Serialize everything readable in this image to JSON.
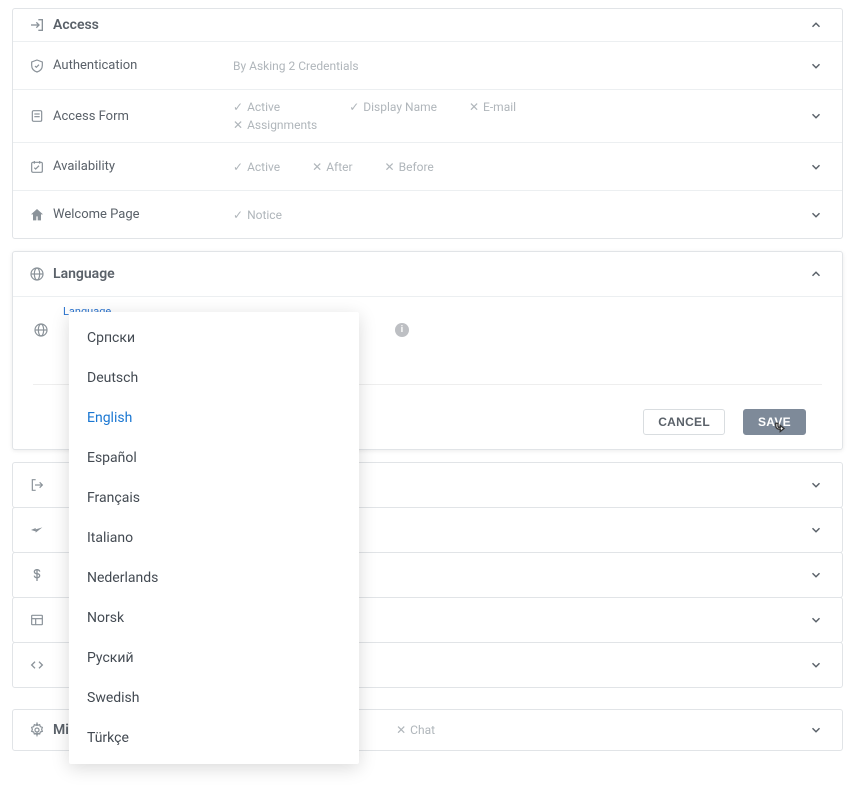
{
  "access": {
    "title": "Access",
    "rows": {
      "authentication": {
        "label": "Authentication",
        "summary": "By Asking 2 Credentials"
      },
      "accessForm": {
        "label": "Access Form",
        "facts": {
          "active": {
            "text": "Active",
            "on": true
          },
          "assignments": {
            "text": "Assignments",
            "on": false
          },
          "displayName": {
            "text": "Display Name",
            "on": true
          },
          "email": {
            "text": "E-mail",
            "on": false
          }
        }
      },
      "availability": {
        "label": "Availability",
        "facts": {
          "active": {
            "text": "Active",
            "on": true
          },
          "after": {
            "text": "After",
            "on": false
          },
          "before": {
            "text": "Before",
            "on": false
          }
        }
      },
      "welcome": {
        "label": "Welcome Page",
        "facts": {
          "notice": {
            "text": "Notice",
            "on": true
          }
        }
      }
    }
  },
  "language": {
    "title": "Language",
    "fieldLabel": "Language",
    "options": [
      "Српски",
      "Deutsch",
      "English",
      "Español",
      "Français",
      "Italiano",
      "Nederlands",
      "Norsk",
      "Руский",
      "Swedish",
      "Türkçe"
    ],
    "selected": "English",
    "buttons": {
      "cancel": "CANCEL",
      "save": "SAVE"
    }
  },
  "lowerRows": {
    "logout": "",
    "share": "",
    "dollar": "",
    "layout": "",
    "code": ""
  },
  "misc": {
    "titlePrefix": "Mis",
    "chat": {
      "text": "Chat",
      "on": false
    }
  }
}
